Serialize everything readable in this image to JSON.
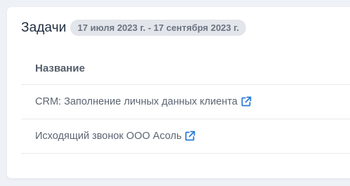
{
  "card": {
    "title": "Задачи",
    "date_range": "17 июля 2023 г. - 17 сентября 2023 г."
  },
  "table": {
    "columns": [
      "Название"
    ],
    "rows": [
      {
        "name": "CRM: Заполнение личных данных клиента",
        "icon": "external-link-icon"
      },
      {
        "name": "Исходящий звонок ООО Асоль",
        "icon": "external-link-icon"
      }
    ]
  },
  "colors": {
    "accent": "#2a7bd6",
    "badge_bg": "#e2e5ea",
    "page_bg": "#eef1f6"
  }
}
